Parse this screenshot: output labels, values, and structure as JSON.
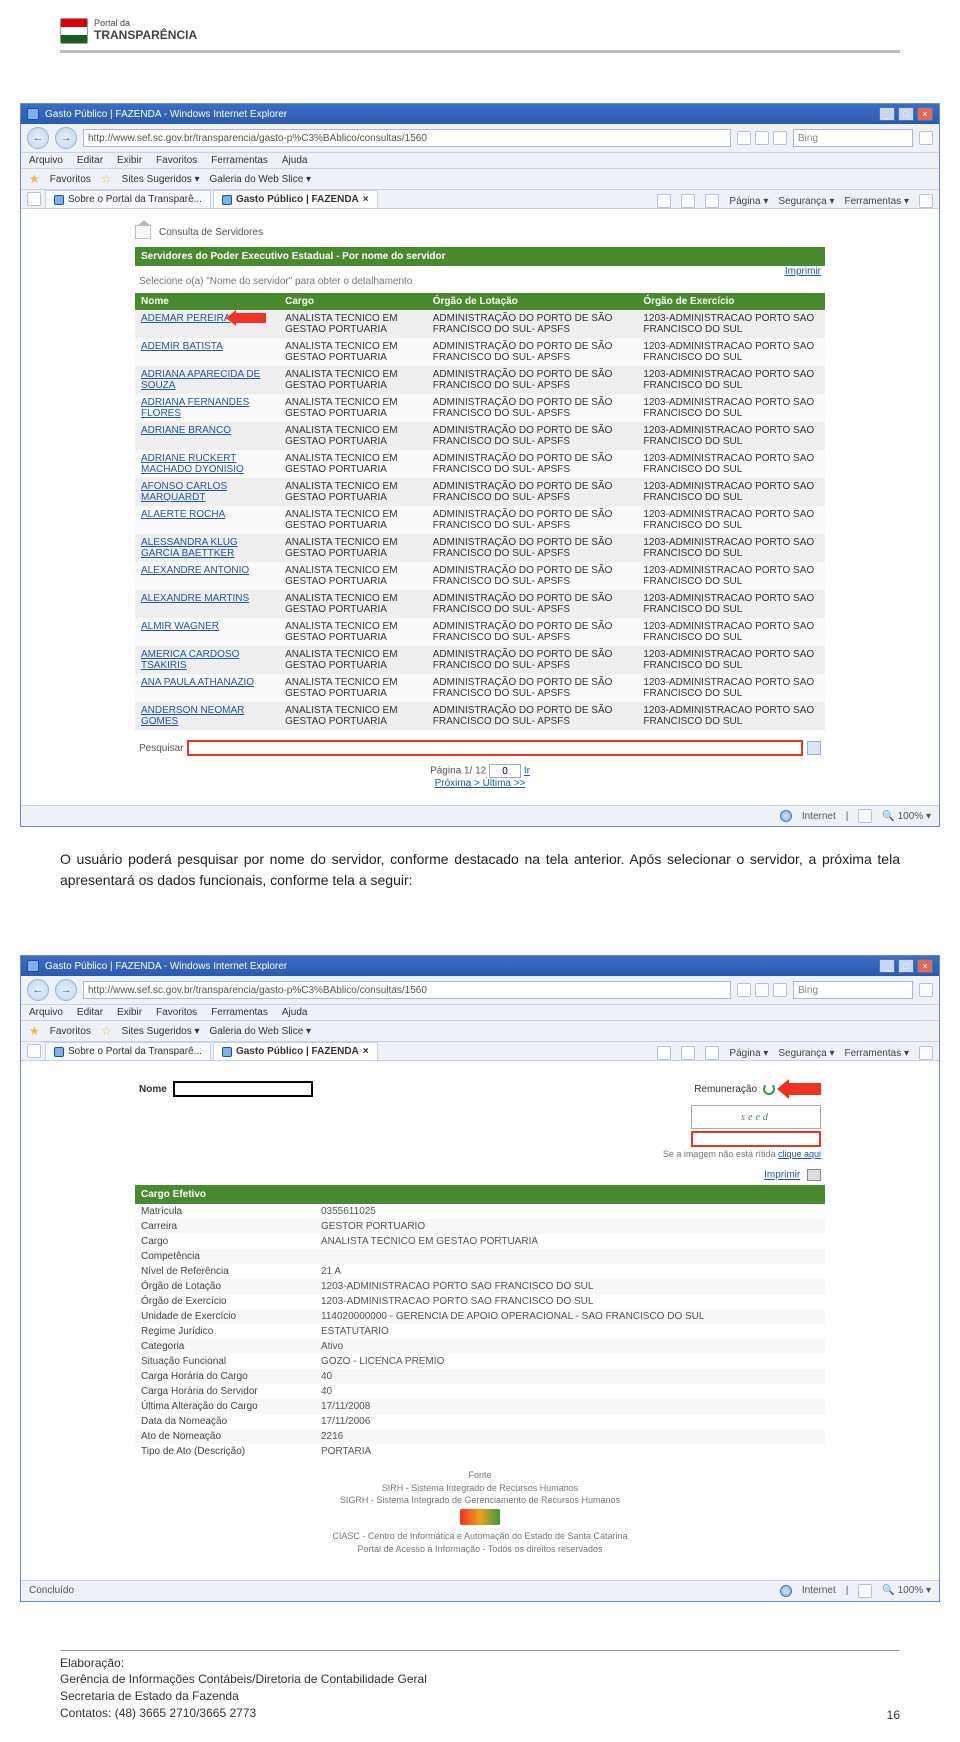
{
  "doc": {
    "logo_top": "Portal da",
    "logo_bottom": "TRANSPARÊNCIA",
    "paragraph": "O usuário poderá pesquisar por nome do servidor, conforme destacado na tela anterior. Após selecionar o servidor, a próxima tela apresentará os dados funcionais, conforme tela a seguir:",
    "footer_l1": "Elaboração:",
    "footer_l2": "Gerência de Informações Contábeis/Diretoria de Contabilidade Geral",
    "footer_l3": "Secretaria de Estado da Fazenda",
    "footer_l4": "Contatos: (48) 3665 2710/3665 2773",
    "page_number": "16"
  },
  "browser": {
    "title": "Gasto Público | FAZENDA - Windows Internet Explorer",
    "url": "http://www.sef.sc.gov.br/transparencia/gasto-p%C3%BAblico/consultas/1560",
    "search_placeholder": "Bing",
    "menu": [
      "Arquivo",
      "Editar",
      "Exibir",
      "Favoritos",
      "Ferramentas",
      "Ajuda"
    ],
    "fav_label": "Favoritos",
    "fav_links": [
      "Sites Sugeridos ▾",
      "Galeria do Web Slice ▾"
    ],
    "tabs": [
      "Sobre o Portal da Transparê...",
      "Gasto Público | FAZENDA"
    ],
    "tool_items": [
      "Página ▾",
      "Segurança ▾",
      "Ferramentas ▾"
    ],
    "status_net": "Internet",
    "status_zoom": "100%"
  },
  "page1": {
    "crumb": "Consulta de Servidores",
    "section_title": "Servidores do Poder Executivo Estadual - Por nome do servidor",
    "subtitle": "Selecione o(a) \"Nome do servidor\" para obter o detalhamento",
    "imprimir": "Imprimir",
    "columns": [
      "Nome",
      "Cargo",
      "Órgão de Lotação",
      "Órgão de Exercício"
    ],
    "common_cargo": "ANALISTA TECNICO EM GESTAO PORTUARIA",
    "common_lotacao": "ADMINISTRAÇÃO DO PORTO DE SÃO FRANCISCO DO SUL- APSFS",
    "common_exerc": "1203-ADMINISTRACAO PORTO SAO FRANCISCO DO SUL",
    "rows": [
      "ADEMAR PEREIRA",
      "ADEMIR BATISTA",
      "ADRIANA APARECIDA DE SOUZA",
      "ADRIANA FERNANDES FLORES",
      "ADRIANE BRANCO",
      "ADRIANE RUCKERT MACHADO DYONISIO",
      "AFONSO CARLOS MARQUARDT",
      "ALAERTE ROCHA",
      "ALESSANDRA KLUG GARCIA BAETTKER",
      "ALEXANDRE ANTONIO",
      "ALEXANDRE MARTINS",
      "ALMIR WAGNER",
      "AMERICA CARDOSO TSAKIRIS",
      "ANA PAULA ATHANAZIO",
      "ANDERSON NEOMAR GOMES"
    ],
    "pesquisar_lbl": "Pesquisar",
    "pager_txt_a": "Página  1/ 12",
    "pager_input": "0",
    "pager_ir": "Ir",
    "pager_links": "Próxima >  Última >>"
  },
  "page2": {
    "nome_lbl": "Nome",
    "remun_link": "Remuneração",
    "captcha_text": "seed",
    "captcha_note": "Se a imagem não está rítida",
    "captcha_link": "clique aqui",
    "imprimir": "Imprimir",
    "section_title": "Cargo Efetivo",
    "fields": [
      [
        "Matrícula",
        "0355611025"
      ],
      [
        "Carreira",
        "GESTOR PORTUARIO"
      ],
      [
        "Cargo",
        "ANALISTA TECNICO EM GESTAO PORTUARIA"
      ],
      [
        "Competência",
        ""
      ],
      [
        "Nível de Referência",
        "21 A"
      ],
      [
        "Órgão de Lotação",
        "1203-ADMINISTRACAO PORTO SAO FRANCISCO DO SUL"
      ],
      [
        "Órgão de Exercício",
        "1203-ADMINISTRACAO PORTO SAO FRANCISCO DO SUL"
      ],
      [
        "Unidade de Exercício",
        "114020000000 - GERENCIA DE APOIO OPERACIONAL - SAO FRANCISCO DO SUL"
      ],
      [
        "Regime Jurídico",
        "ESTATUTARIO"
      ],
      [
        "Categoria",
        "Ativo"
      ],
      [
        "Situação Funcional",
        "GOZO - LICENCA PREMIO"
      ],
      [
        "Carga Horária do Cargo",
        "40"
      ],
      [
        "Carga Horária do Servidor",
        "40"
      ],
      [
        "Última Alteração do Cargo",
        "17/11/2008"
      ],
      [
        "Data da Nomeação",
        "17/11/2006"
      ],
      [
        "Ato de Nomeação",
        "2216"
      ],
      [
        "Tipo de Ato (Descrição)",
        "PORTARIA"
      ]
    ],
    "fonte_lbl": "Fonte",
    "fonte_l1": "SIRH - Sistema Integrado de Recursos Humanos",
    "fonte_l2": "SIGRH - Sistema Integrado de Gerenciamento de Recursos Humanos",
    "ciasc_l1": "CIASC - Centro de Informática e Automação do Estado de Santa Catarina",
    "ciasc_l2": "Portal de Acesso a Informação - Todos os direitos reservados",
    "status_done": "Concluído"
  }
}
